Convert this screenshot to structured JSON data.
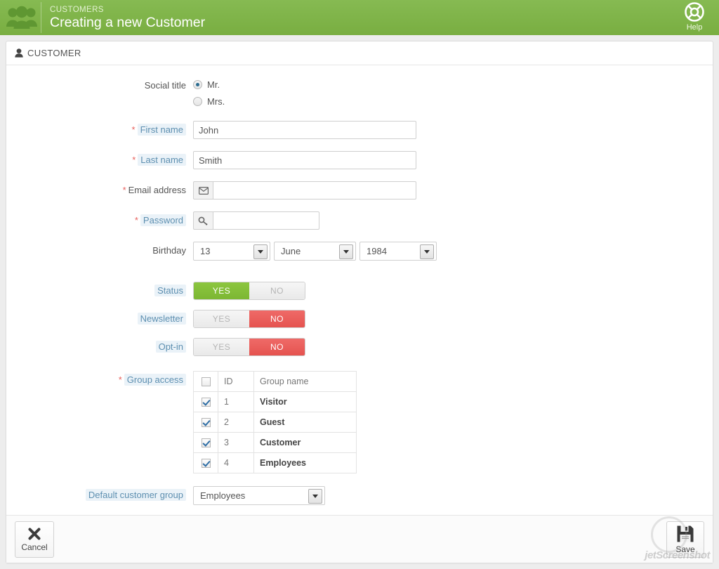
{
  "topbar": {
    "eyebrow": "CUSTOMERS",
    "title": "Creating a new Customer",
    "brand_icon": "customers-group-icon",
    "help_icon": "lifebuoy-icon",
    "help_label": "Help",
    "bg_color": "#7cb342"
  },
  "panel": {
    "icon": "user-icon",
    "title": "CUSTOMER"
  },
  "form": {
    "social_title": {
      "label": "Social title",
      "options": [
        {
          "label": "Mr.",
          "selected": true
        },
        {
          "label": "Mrs.",
          "selected": false
        }
      ]
    },
    "first_name": {
      "label": "First name",
      "required": true,
      "required_mark": "*",
      "value": "John",
      "placeholder": ""
    },
    "last_name": {
      "label": "Last name",
      "required": true,
      "required_mark": "*",
      "value": "Smith",
      "placeholder": ""
    },
    "email": {
      "label": "Email address",
      "required": true,
      "required_mark": "*",
      "icon": "envelope-icon",
      "value": "",
      "placeholder": ""
    },
    "password": {
      "label": "Password",
      "required": true,
      "required_mark": "*",
      "icon": "key-icon",
      "value": "",
      "placeholder": ""
    },
    "birthday": {
      "label": "Birthday",
      "day": "13",
      "month": "June",
      "year": "1984"
    },
    "status": {
      "label": "Status",
      "yes_label": "YES",
      "no_label": "NO",
      "value": "YES"
    },
    "newsletter": {
      "label": "Newsletter",
      "yes_label": "YES",
      "no_label": "NO",
      "value": "NO"
    },
    "optin": {
      "label": "Opt-in",
      "yes_label": "YES",
      "no_label": "NO",
      "value": "NO"
    },
    "group_access": {
      "label": "Group access",
      "required": true,
      "required_mark": "*",
      "columns": [
        "",
        "ID",
        "Group name"
      ],
      "select_all_checked": false,
      "rows": [
        {
          "checked": true,
          "id": "1",
          "name": "Visitor"
        },
        {
          "checked": true,
          "id": "2",
          "name": "Guest"
        },
        {
          "checked": true,
          "id": "3",
          "name": "Customer"
        },
        {
          "checked": true,
          "id": "4",
          "name": "Employees"
        }
      ]
    },
    "default_group": {
      "label": "Default customer group",
      "value": "Employees"
    }
  },
  "footer": {
    "cancel": {
      "label": "Cancel",
      "icon": "close-x-icon"
    },
    "save": {
      "label": "Save",
      "icon": "floppy-disk-icon"
    },
    "watermark": "jetScreenshot"
  },
  "colors": {
    "green": "#7cb342",
    "switch_yes": "#8cc63f",
    "switch_no": "#e5534f",
    "required": "#e8635f",
    "hint_text": "#5d8fb0",
    "hint_bg": "#eaf2f8"
  }
}
